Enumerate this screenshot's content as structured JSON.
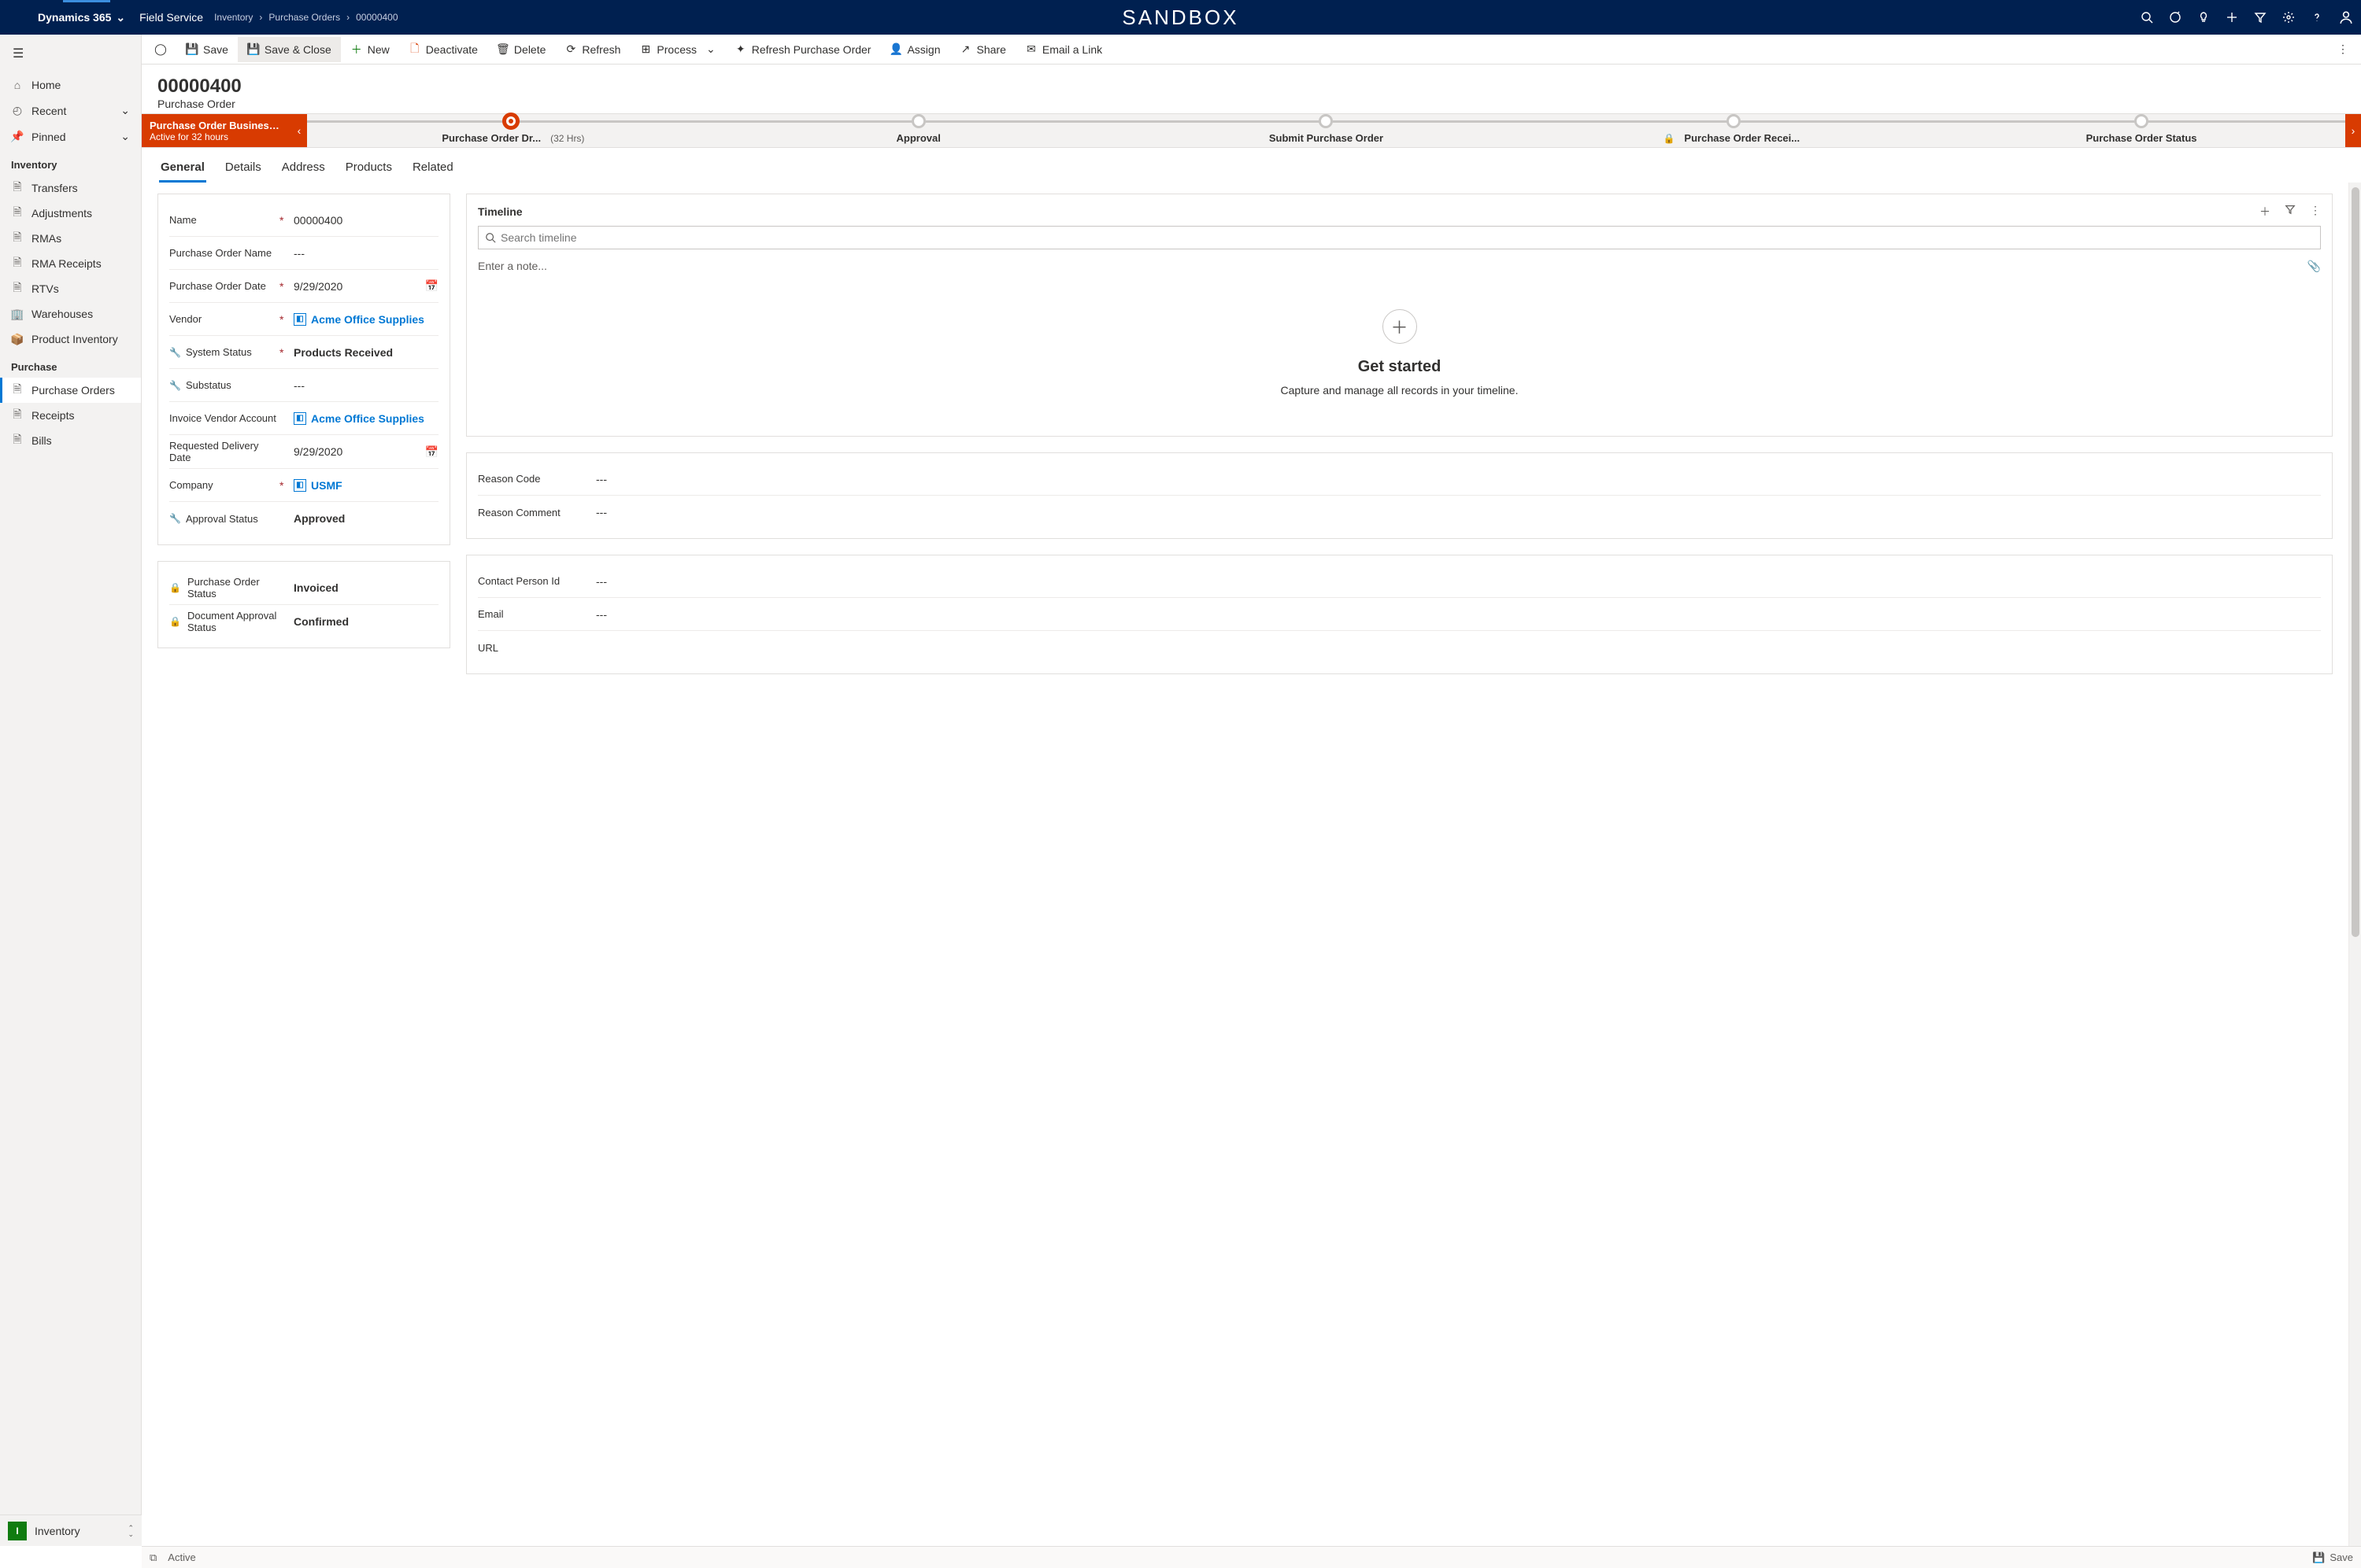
{
  "topbar": {
    "brand": "Dynamics 365",
    "app": "Field Service",
    "center": "SANDBOX",
    "crumbs": [
      "Inventory",
      "Purchase Orders",
      "00000400"
    ]
  },
  "sidebar": {
    "home": "Home",
    "recent": "Recent",
    "pinned": "Pinned",
    "group1": "Inventory",
    "items1": [
      "Transfers",
      "Adjustments",
      "RMAs",
      "RMA Receipts",
      "RTVs",
      "Warehouses",
      "Product Inventory"
    ],
    "group2": "Purchase",
    "items2": [
      "Purchase Orders",
      "Receipts",
      "Bills"
    ],
    "area_badge": "I",
    "area": "Inventory"
  },
  "cmdbar": {
    "save": "Save",
    "saveclose": "Save & Close",
    "new": "New",
    "deactivate": "Deactivate",
    "delete": "Delete",
    "refresh": "Refresh",
    "process": "Process",
    "refreshpo": "Refresh Purchase Order",
    "assign": "Assign",
    "share": "Share",
    "email": "Email a Link"
  },
  "header": {
    "title": "00000400",
    "subtitle": "Purchase Order"
  },
  "bpf": {
    "proc_title": "Purchase Order Business ...",
    "proc_sub": "Active for 32 hours",
    "stages": [
      {
        "label": "Purchase Order Dr...",
        "dur": "(32 Hrs)",
        "active": true
      },
      {
        "label": "Approval"
      },
      {
        "label": "Submit Purchase Order"
      },
      {
        "label": "Purchase Order Recei...",
        "locked": true
      },
      {
        "label": "Purchase Order Status"
      }
    ]
  },
  "tabs": [
    "General",
    "Details",
    "Address",
    "Products",
    "Related"
  ],
  "form": {
    "name_label": "Name",
    "name": "00000400",
    "poname_label": "Purchase Order Name",
    "poname": "---",
    "podate_label": "Purchase Order Date",
    "podate": "9/29/2020",
    "vendor_label": "Vendor",
    "vendor": "Acme Office Supplies",
    "sysstatus_label": "System Status",
    "sysstatus": "Products Received",
    "substatus_label": "Substatus",
    "substatus": "---",
    "invacct_label": "Invoice Vendor Account",
    "invacct": "Acme Office Supplies",
    "reqdate_label": "Requested Delivery Date",
    "reqdate": "9/29/2020",
    "company_label": "Company",
    "company": "USMF",
    "appstatus_label": "Approval Status",
    "appstatus": "Approved",
    "postatus_label": "Purchase Order Status",
    "postatus": "Invoiced",
    "docapp_label": "Document Approval Status",
    "docapp": "Confirmed"
  },
  "timeline": {
    "title": "Timeline",
    "search_ph": "Search timeline",
    "note_ph": "Enter a note...",
    "gs": "Get started",
    "gd": "Capture and manage all records in your timeline."
  },
  "right2": {
    "reason_label": "Reason Code",
    "reason": "---",
    "comment_label": "Reason Comment",
    "comment": "---"
  },
  "right3": {
    "contact_label": "Contact Person Id",
    "contact": "---",
    "email_label": "Email",
    "email": "---",
    "url_label": "URL"
  },
  "statusbar": {
    "status": "Active",
    "save": "Save"
  }
}
